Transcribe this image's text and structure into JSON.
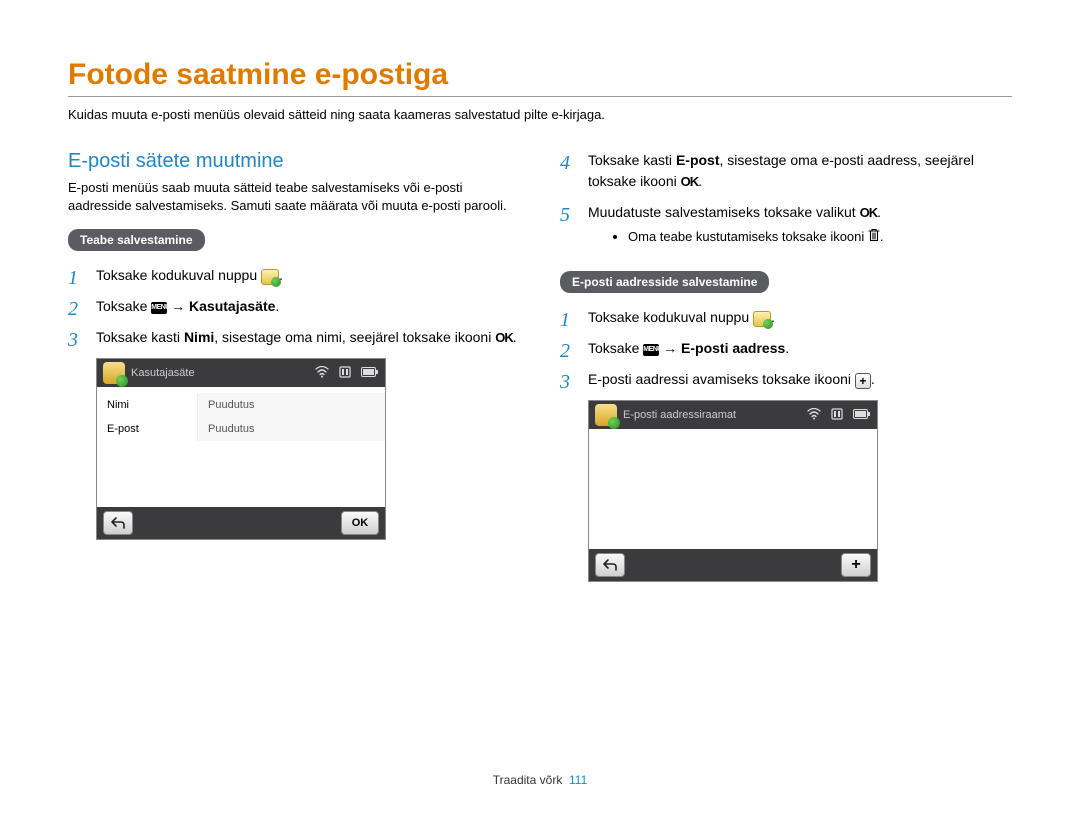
{
  "title": "Fotode saatmine e-postiga",
  "intro": "Kuidas muuta e-posti menüüs olevaid sätteid ning saata kaameras salvestatud pilte e-kirjaga.",
  "left": {
    "heading": "E-posti sätete muutmine",
    "desc": "E-posti menüüs saab muuta sätteid teabe salvestamiseks või e-posti aadresside salvestamiseks. Samuti saate määrata või muuta e-posti parooli.",
    "pill": "Teabe salvestamine",
    "step1_a": "Toksake kodukuval nuppu ",
    "step1_b": ".",
    "step2_a": "Toksake ",
    "step2_arrow": " → ",
    "step2_bold": "Kasutajasäte",
    "step2_b": ".",
    "step3_a": "Toksake kasti ",
    "step3_bold": "Nimi",
    "step3_b": ", sisestage oma nimi, seejärel toksake ikooni ",
    "step3_c": ".",
    "device": {
      "title": "Kasutajasäte",
      "row1_label": "Nimi",
      "row1_value": "Puudutus",
      "row2_label": "E-post",
      "row2_value": "Puudutus",
      "back": "↩",
      "ok": "OK"
    }
  },
  "right": {
    "step4_a": "Toksake kasti ",
    "step4_bold": "E-post",
    "step4_b": ", sisestage oma e-posti aadress, seejärel toksake ikooni ",
    "step4_c": ".",
    "step5_a": "Muudatuste salvestamiseks toksake valikut ",
    "step5_b": ".",
    "sub_bullet": "Oma teabe kustutamiseks toksake ikooni ",
    "pill": "E-posti aadresside salvestamine",
    "b_step1_a": "Toksake kodukuval nuppu ",
    "b_step1_b": ".",
    "b_step2_a": "Toksake ",
    "b_step2_arrow": " → ",
    "b_step2_bold": "E-posti aadress",
    "b_step2_b": ".",
    "b_step3_a": "E-posti aadressi avamiseks toksake ikooni ",
    "b_step3_b": ".",
    "device": {
      "title": "E-posti aadressiraamat",
      "back": "↩",
      "plus": "+"
    }
  },
  "footer": {
    "section": "Traadita võrk",
    "page": "111"
  },
  "glyphs": {
    "menu": "MENU",
    "ok": "OK",
    "wifi": "⧜",
    "sd": "▥",
    "batt": "▮"
  }
}
